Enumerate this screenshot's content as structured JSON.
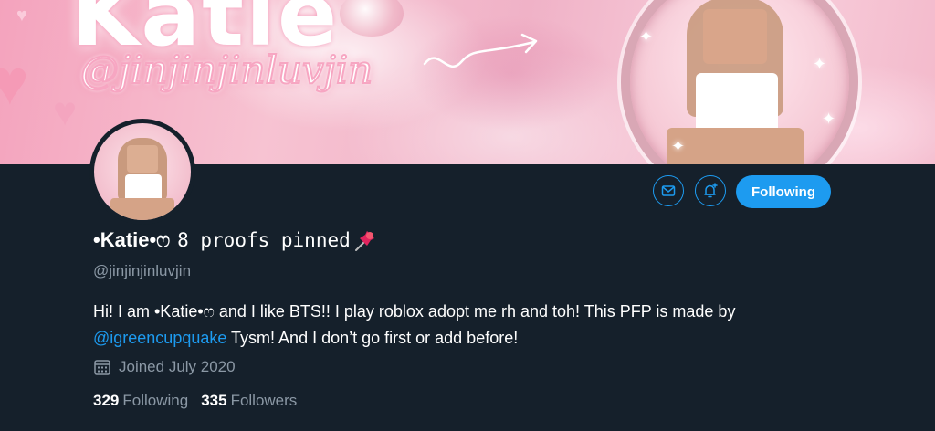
{
  "banner": {
    "name_art": "Katie",
    "handle_art": "@jinjinjinluvjin"
  },
  "actions": {
    "message_icon": "mail-icon",
    "notify_icon": "bell-plus-icon",
    "follow_label": "Following"
  },
  "profile": {
    "display_name": "•Katie•ෆ",
    "display_name_suffix": "8 proofs pinned",
    "pin_icon": "pushpin-icon",
    "handle": "@jinjinjinluvjin",
    "bio_part1": "Hi! I am •Katie•ෆ and I like BTS!! I play roblox adopt me rh and toh! This PFP is made by ",
    "bio_mention": "@igreencupquake",
    "bio_part2": " Tysm! And I don’t go first or add before!",
    "joined_icon": "calendar-icon",
    "joined": "Joined July 2020"
  },
  "stats": {
    "following_count": "329",
    "following_label": "Following",
    "followers_count": "335",
    "followers_label": "Followers"
  },
  "colors": {
    "background": "#15202b",
    "accent": "#1d9bf0",
    "muted": "#8b98a5"
  }
}
